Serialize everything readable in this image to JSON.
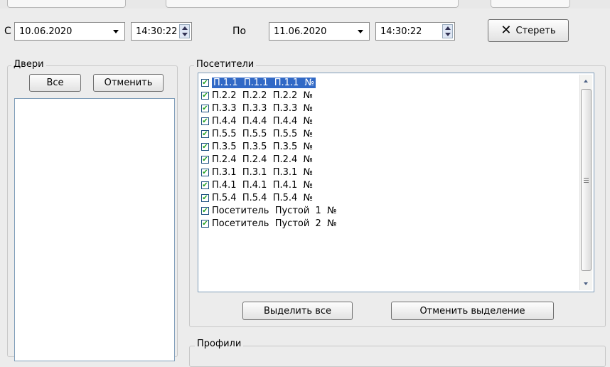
{
  "filters": {
    "from_label": "С",
    "from_date": "10.06.2020",
    "from_time": "14:30:22",
    "to_label": "По",
    "to_date": "11.06.2020",
    "to_time": "14:30:22",
    "clear_label": "Стереть"
  },
  "doors": {
    "title": "Двери",
    "all_label": "Все",
    "cancel_label": "Отменить"
  },
  "visitors": {
    "title": "Посетители",
    "items": [
      {
        "label": "П.1.1  П.1.1  П.1.1  №",
        "checked": true,
        "selected": true
      },
      {
        "label": "П.2.2  П.2.2  П.2.2  №",
        "checked": true,
        "selected": false
      },
      {
        "label": "П.3.3  П.3.3  П.3.3  №",
        "checked": true,
        "selected": false
      },
      {
        "label": "П.4.4  П.4.4  П.4.4  №",
        "checked": true,
        "selected": false
      },
      {
        "label": "П.5.5  П.5.5  П.5.5  №",
        "checked": true,
        "selected": false
      },
      {
        "label": "П.3.5  П.3.5  П.3.5  №",
        "checked": true,
        "selected": false
      },
      {
        "label": "П.2.4  П.2.4  П.2.4  №",
        "checked": true,
        "selected": false
      },
      {
        "label": "П.3.1  П.3.1  П.3.1  №",
        "checked": true,
        "selected": false
      },
      {
        "label": "П.4.1  П.4.1  П.4.1  №",
        "checked": true,
        "selected": false
      },
      {
        "label": "П.5.4  П.5.4  П.5.4  №",
        "checked": true,
        "selected": false
      },
      {
        "label": "Посетитель  Пустой  1  №",
        "checked": true,
        "selected": false
      },
      {
        "label": "Посетитель  Пустой  2  №",
        "checked": true,
        "selected": false
      }
    ],
    "select_all_label": "Выделить все",
    "deselect_label": "Отменить выделение"
  },
  "profiles": {
    "title": "Профили"
  }
}
